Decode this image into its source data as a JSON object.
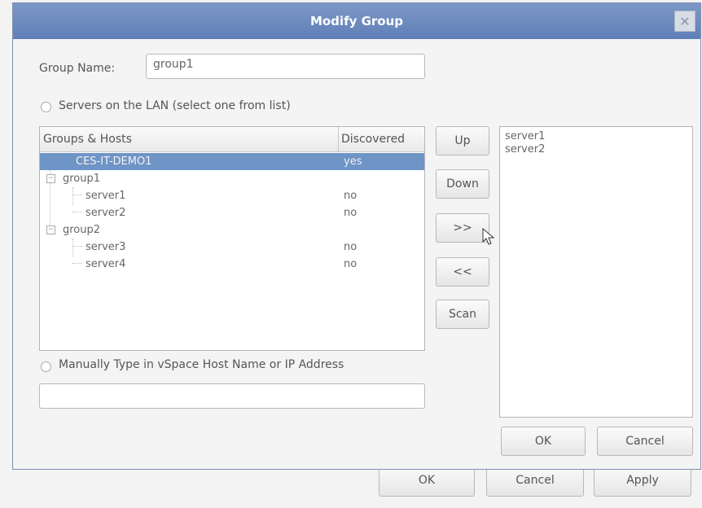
{
  "dialog": {
    "title": "Modify Group",
    "close_glyph": "✕",
    "group_name_label": "Group Name:",
    "group_name_value": "group1",
    "radio_lan_label": "Servers on the LAN (select one from list)",
    "radio_manual_label": "Manually Type in vSpace Host Name or IP Address",
    "manual_value": ""
  },
  "tree": {
    "headers": [
      "Groups & Hosts",
      "Discovered"
    ],
    "rows": [
      {
        "name": "CES-IT-DEMO1",
        "discovered": "yes"
      },
      {
        "name": "group1",
        "discovered": ""
      },
      {
        "name": "server1",
        "discovered": "no"
      },
      {
        "name": "server2",
        "discovered": "no"
      },
      {
        "name": "group2",
        "discovered": ""
      },
      {
        "name": "server3",
        "discovered": "no"
      },
      {
        "name": "server4",
        "discovered": "no"
      }
    ]
  },
  "buttons": {
    "up": "Up",
    "down": "Down",
    "add": ">>",
    "remove": "<<",
    "scan": "Scan",
    "ok": "OK",
    "cancel": "Cancel"
  },
  "selected_list": [
    "server1",
    "server2"
  ],
  "background_dialog": {
    "ok": "OK",
    "cancel": "Cancel",
    "apply": "Apply"
  },
  "colors": {
    "titlebar": "#6a88bd",
    "selection": "#6f94c6"
  },
  "icons": [
    "close-icon",
    "tree-expander-icon",
    "mouse-cursor-icon"
  ]
}
